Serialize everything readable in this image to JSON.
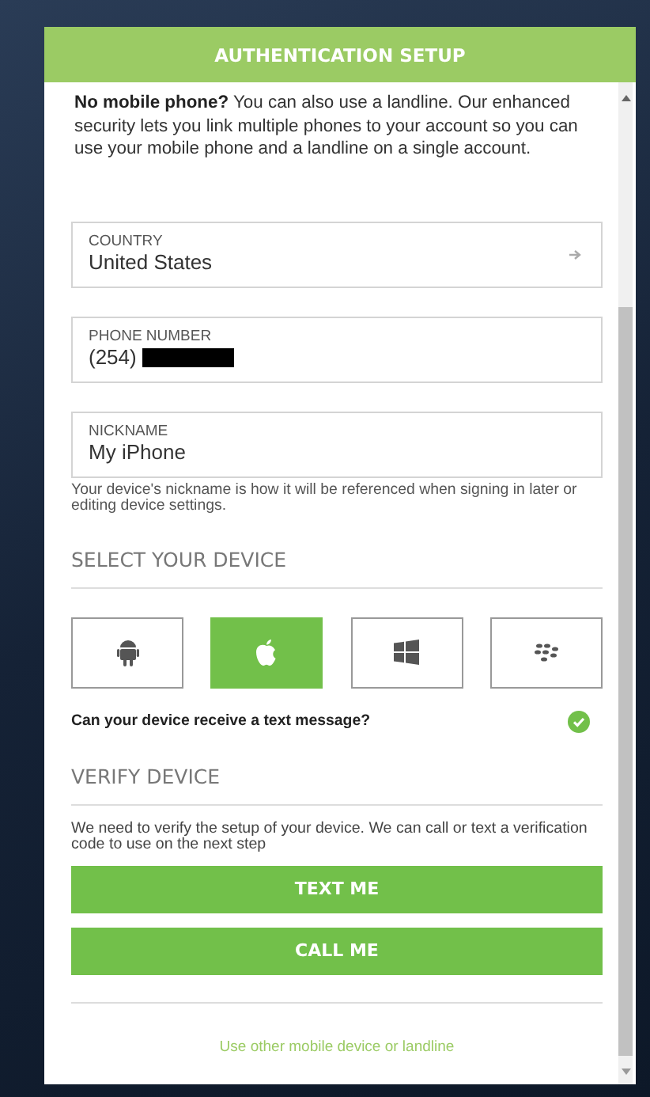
{
  "header": {
    "title": "AUTHENTICATION SETUP"
  },
  "intro": "**No mobile phone?** You can also use a landline. Our enhanced security lets you link multiple phones to your account so you can use your mobile phone and a landline on a single account.",
  "fields": [
    {
      "kind": "select",
      "label": "COUNTRY",
      "value": "United States"
    },
    {
      "kind": "phone",
      "label": "PHONE NUMBER",
      "value": "(254)",
      "redacted": true
    },
    {
      "kind": "text",
      "label": "NICKNAME",
      "value": "My iPhone"
    }
  ],
  "nickname_help": "Your device's nickname is how it will be referenced when signing in later or editing device settings.",
  "device_section": {
    "heading": "SELECT YOUR DEVICE",
    "devices": [
      {
        "kind": "android",
        "selected": false
      },
      {
        "kind": "apple",
        "selected": true
      },
      {
        "kind": "windows",
        "selected": false
      },
      {
        "kind": "blackberry",
        "selected": false
      }
    ]
  },
  "text_capable": {
    "label": "Can your device receive a text message?",
    "checked": true
  },
  "verify_section": {
    "heading": "VERIFY DEVICE",
    "description": "We need to verify the setup of your device. We can call or text a verification code to use on the next step",
    "buttons": [
      "TEXT ME",
      "CALL ME"
    ]
  },
  "other_device_link": "Use other mobile device or landline"
}
